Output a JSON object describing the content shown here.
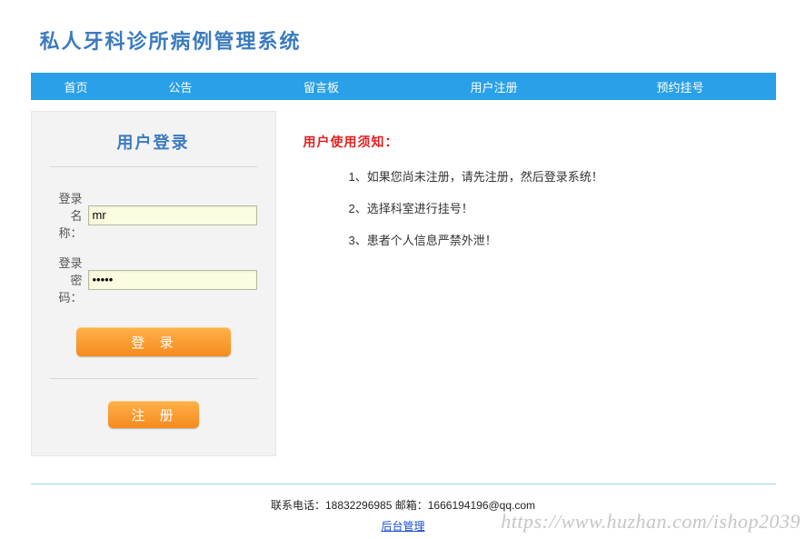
{
  "header": {
    "site_title": "私人牙科诊所病例管理系统"
  },
  "nav": {
    "items": [
      {
        "label": "首页"
      },
      {
        "label": "公告"
      },
      {
        "label": "留言板"
      },
      {
        "label": "用户注册"
      },
      {
        "label": "预约挂号"
      }
    ]
  },
  "login": {
    "panel_title": "用户登录",
    "username_label": "登录名称：",
    "username_value": "mr",
    "password_label": "登录密码：",
    "password_value": "•••••",
    "login_btn": "登 录",
    "register_btn": "注 册"
  },
  "notice": {
    "title": "用户使用须知：",
    "items": [
      "1、如果您尚未注册，请先注册，然后登录系统！",
      "2、选择科室进行挂号！",
      "3、患者个人信息严禁外泄！"
    ]
  },
  "footer": {
    "phone_label": "联系电话：",
    "phone_value": "18832296985",
    "email_label": " 邮箱：",
    "email_value": "1666194196@qq.com",
    "admin_link": "后台管理"
  },
  "watermark": "https://www.huzhan.com/ishop2039"
}
